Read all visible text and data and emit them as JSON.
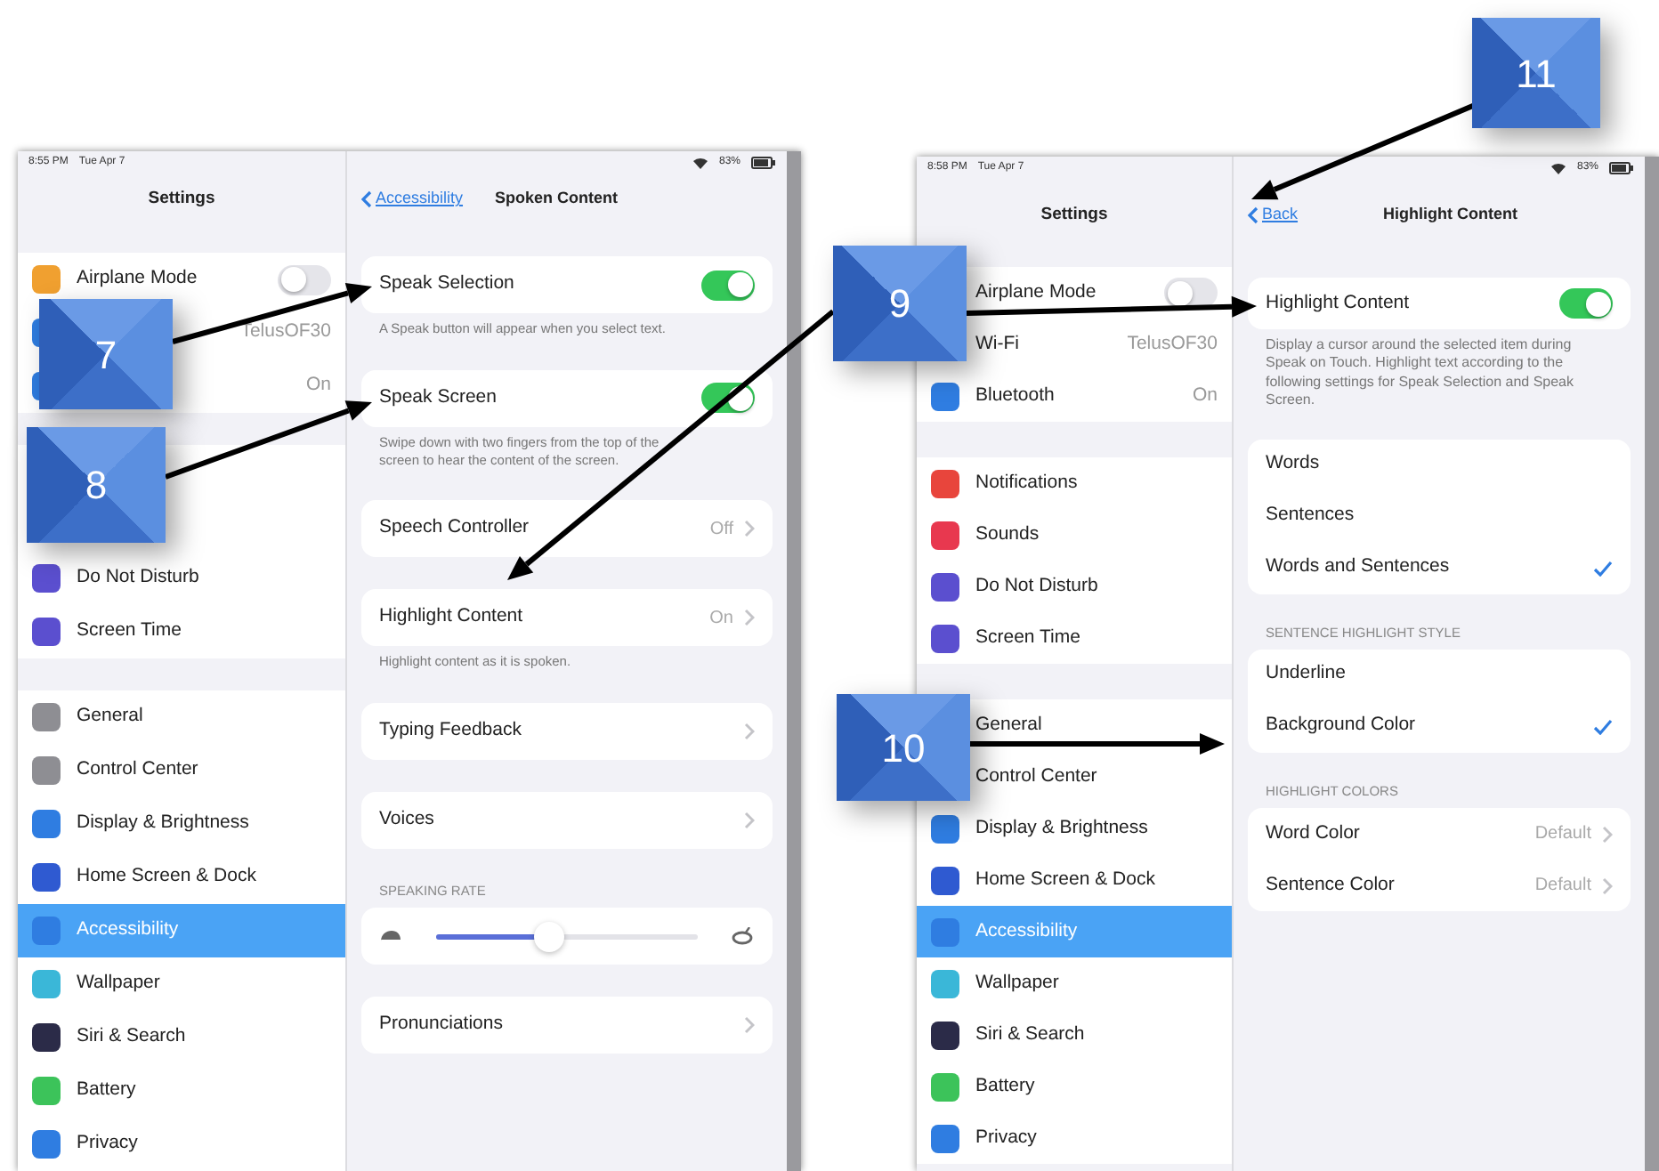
{
  "screens": [
    {
      "status_bar": {
        "time": "8:55 PM",
        "date": "Tue Apr 7",
        "battery": "83%"
      },
      "sidebar": {
        "title": "Settings",
        "groups": [
          [
            {
              "kind": "toggle",
              "label": "Airplane Mode",
              "on": false,
              "color": "#f0a030"
            },
            {
              "kind": "value",
              "value": "TelusOF30",
              "color": "#2f7de1"
            },
            {
              "kind": "value",
              "value": "On",
              "color": "#2f7de1"
            }
          ],
          [
            {
              "kind": "plain"
            },
            {
              "kind": "plain"
            },
            {
              "kind": "plain",
              "label": "Do Not Disturb",
              "color": "#5b4fcf",
              "selected": false
            },
            {
              "kind": "plain",
              "label": "Screen Time",
              "color": "#5b4fcf",
              "selected": false
            }
          ],
          [
            {
              "kind": "plain",
              "label": "General",
              "color": "#8e8e93",
              "selected": false
            },
            {
              "kind": "plain",
              "label": "Control Center",
              "color": "#8e8e93",
              "selected": false
            },
            {
              "kind": "plain",
              "label": "Display & Brightness",
              "color": "#2f7de1",
              "selected": false
            },
            {
              "kind": "plain",
              "label": "Home Screen & Dock",
              "color": "#2f5ad1",
              "selected": false
            },
            {
              "kind": "plain",
              "label": "Accessibility",
              "color": "#2f7de1",
              "selected": true
            },
            {
              "kind": "plain",
              "label": "Wallpaper",
              "color": "#3ab7d8",
              "selected": false
            },
            {
              "kind": "plain",
              "label": "Siri & Search",
              "color": "#2b2b48",
              "selected": false
            },
            {
              "kind": "plain",
              "label": "Battery",
              "color": "#3cc35a",
              "selected": false
            },
            {
              "kind": "plain",
              "label": "Privacy",
              "color": "#2f7de1",
              "selected": false
            }
          ]
        ]
      },
      "detail": {
        "back": "Accessibility",
        "title": "Spoken Content",
        "sections": [
          {
            "rows": [
              {
                "kind": "switch",
                "label": "Speak Selection",
                "on": true
              }
            ],
            "footer": "A Speak button will appear when you select text."
          },
          {
            "rows": [
              {
                "kind": "switch",
                "label": "Speak Screen",
                "on": true
              }
            ],
            "footer": "Swipe down with two fingers from the top of the screen to hear the content of the screen."
          },
          {
            "rows": [
              {
                "kind": "disclosure",
                "label": "Speech Controller",
                "value": "Off"
              }
            ]
          },
          {
            "rows": [
              {
                "kind": "disclosure",
                "label": "Highlight Content",
                "value": "On"
              }
            ],
            "footer": "Highlight content as it is spoken."
          },
          {
            "rows": [
              {
                "kind": "disclosure",
                "label": "Typing Feedback"
              }
            ]
          },
          {
            "rows": [
              {
                "kind": "disclosure",
                "label": "Voices"
              }
            ]
          },
          {
            "header": "SPEAKING RATE",
            "rows": [
              {
                "kind": "slider",
                "level": 0.43
              }
            ]
          },
          {
            "rows": [
              {
                "kind": "disclosure",
                "label": "Pronunciations"
              }
            ]
          }
        ]
      }
    },
    {
      "status_bar": {
        "time": "8:58 PM",
        "date": "Tue Apr 7",
        "battery": "83%"
      },
      "sidebar": {
        "title": "Settings",
        "groups": [
          [
            {
              "kind": "toggle",
              "label": "Airplane Mode",
              "on": false
            },
            {
              "kind": "value",
              "label": "Wi-Fi",
              "value": "TelusOF30"
            },
            {
              "kind": "value",
              "label": "Bluetooth",
              "value": "On",
              "color": "#2f7de1"
            }
          ],
          [
            {
              "kind": "plain",
              "label": "Notifications",
              "color": "#e8453c",
              "selected": false
            },
            {
              "kind": "plain",
              "label": "Sounds",
              "color": "#e8384f",
              "selected": false
            },
            {
              "kind": "plain",
              "label": "Do Not Disturb",
              "color": "#5b4fcf",
              "selected": false
            },
            {
              "kind": "plain",
              "label": "Screen Time",
              "color": "#5b4fcf",
              "selected": false
            }
          ],
          [
            {
              "kind": "plain",
              "label": "General",
              "selected": false
            },
            {
              "kind": "plain",
              "label": "Control Center",
              "selected": false
            },
            {
              "kind": "plain",
              "label": "Display & Brightness",
              "color": "#2f7de1",
              "selected": false
            },
            {
              "kind": "plain",
              "label": "Home Screen & Dock",
              "color": "#2f5ad1",
              "selected": false
            },
            {
              "kind": "plain",
              "label": "Accessibility",
              "color": "#2f7de1",
              "selected": true
            },
            {
              "kind": "plain",
              "label": "Wallpaper",
              "color": "#3ab7d8",
              "selected": false
            },
            {
              "kind": "plain",
              "label": "Siri & Search",
              "color": "#2b2b48",
              "selected": false
            },
            {
              "kind": "plain",
              "label": "Battery",
              "color": "#3cc35a",
              "selected": false
            },
            {
              "kind": "plain",
              "label": "Privacy",
              "color": "#2f7de1",
              "selected": false
            }
          ]
        ]
      },
      "detail": {
        "back": "Back",
        "title": "Highlight Content",
        "sections": [
          {
            "rows": [
              {
                "kind": "switch",
                "label": "Highlight Content",
                "on": true
              }
            ],
            "footer": "Display a cursor around the selected item during Speak on Touch. Highlight text according to the following settings for Speak Selection and Speak Screen."
          },
          {
            "rows": [
              {
                "kind": "option",
                "label": "Words",
                "selected": false
              },
              {
                "kind": "option",
                "label": "Sentences",
                "selected": false
              },
              {
                "kind": "option",
                "label": "Words and Sentences",
                "selected": true
              }
            ]
          },
          {
            "header": "SENTENCE HIGHLIGHT STYLE",
            "rows": [
              {
                "kind": "option",
                "label": "Underline",
                "selected": false
              },
              {
                "kind": "option",
                "label": "Background Color",
                "selected": true
              }
            ]
          },
          {
            "header": "HIGHLIGHT COLORS",
            "rows": [
              {
                "kind": "disclosure",
                "label": "Word Color",
                "value": "Default"
              },
              {
                "kind": "disclosure",
                "label": "Sentence Color",
                "value": "Default"
              }
            ]
          }
        ]
      }
    }
  ],
  "callouts": [
    {
      "number": "7"
    },
    {
      "number": "8"
    },
    {
      "number": "9"
    },
    {
      "number": "10"
    },
    {
      "number": "11"
    }
  ]
}
